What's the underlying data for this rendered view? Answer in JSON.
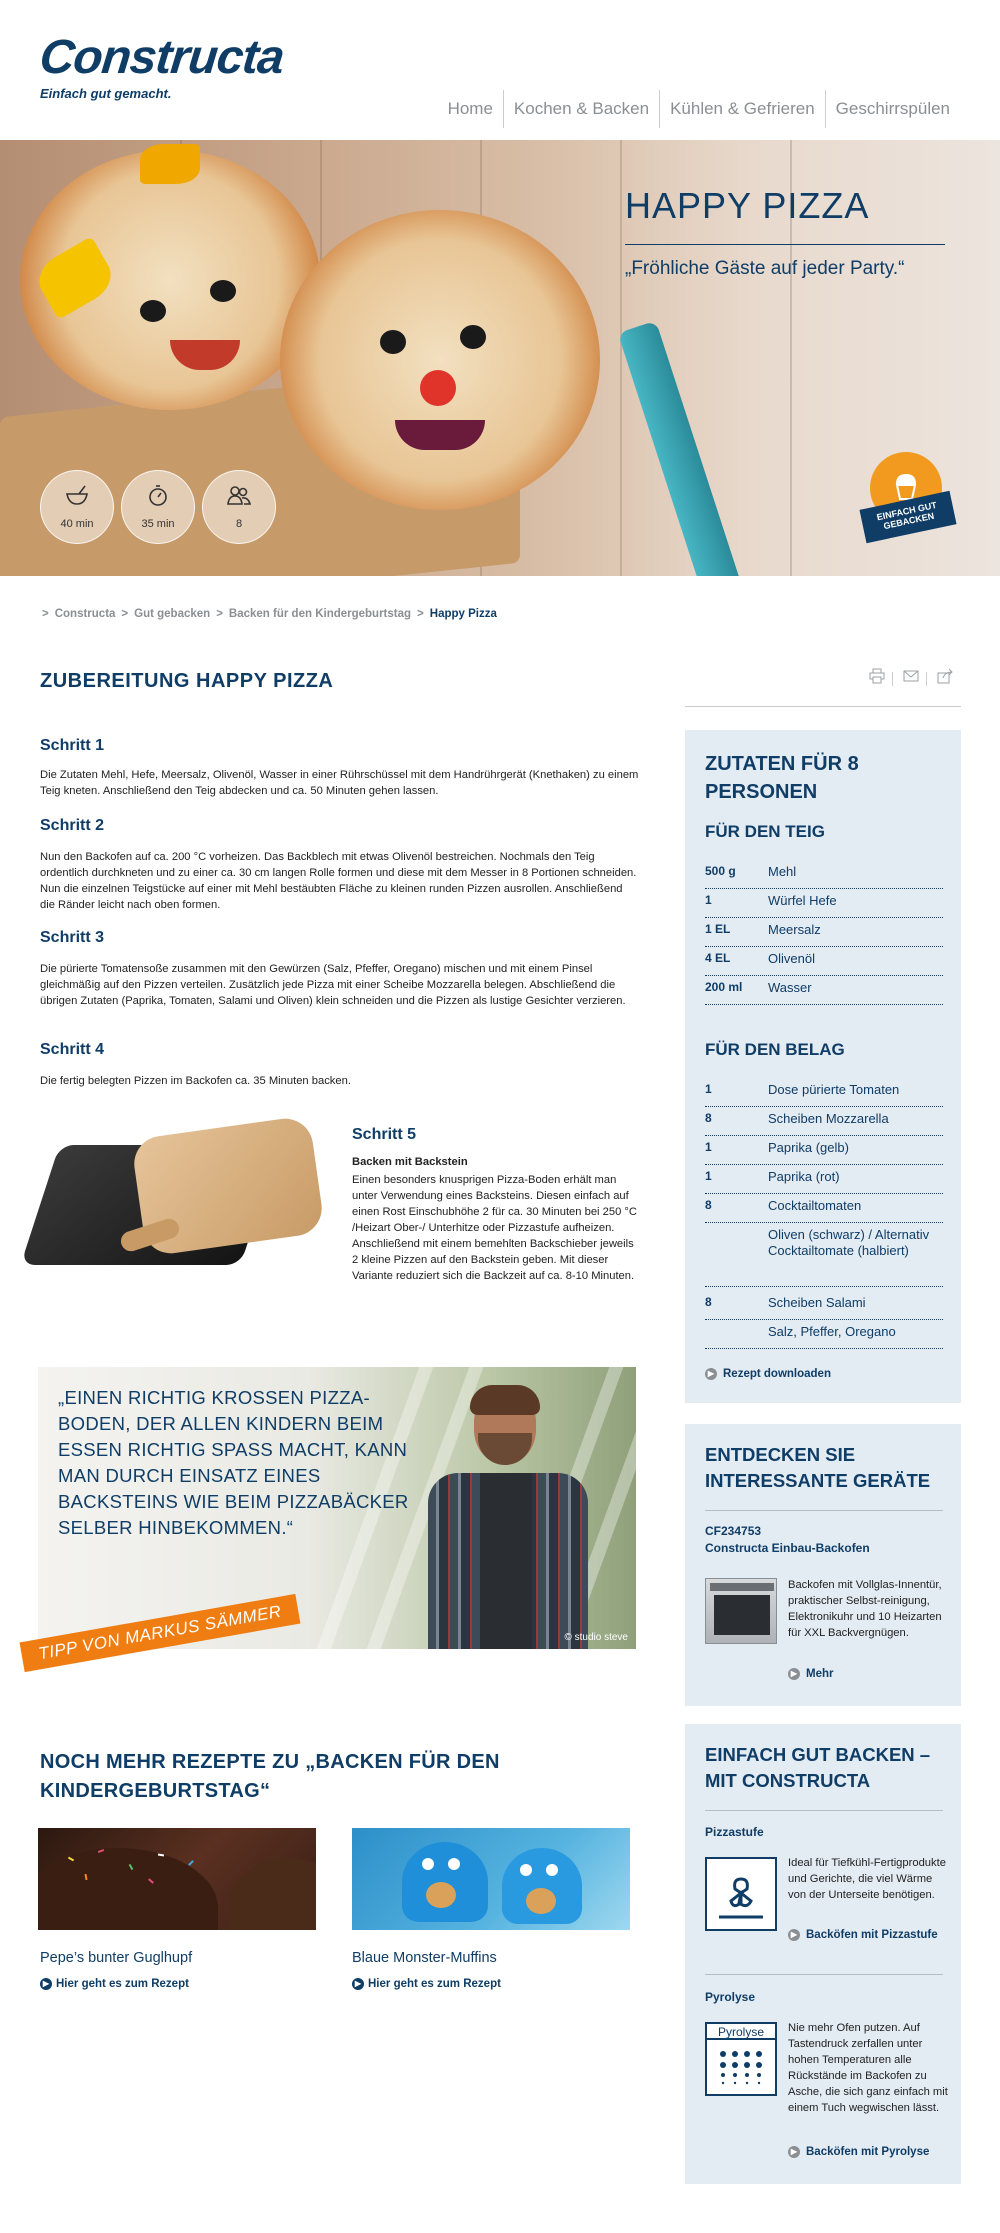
{
  "brand": {
    "logo": "Constructa",
    "tagline": "Einfach gut gemacht."
  },
  "nav": [
    "Home",
    "Kochen & Backen",
    "Kühlen & Gefrieren",
    "Geschirrspülen"
  ],
  "hero": {
    "title": "HAPPY PIZZA",
    "subtitle": "„Fröhliche Gäste auf jeder Party.“",
    "stats": [
      {
        "icon": "mixing-bowl-icon",
        "value": "40 min"
      },
      {
        "icon": "stopwatch-icon",
        "value": "35 min"
      },
      {
        "icon": "people-icon",
        "value": "8"
      }
    ],
    "badge": "EINFACH GUT GEBACKEN"
  },
  "breadcrumb": [
    "Constructa",
    "Gut gebacken",
    "Backen für den Kindergeburtstag",
    "Happy Pizza"
  ],
  "main": {
    "title": "ZUBEREITUNG HAPPY PIZZA",
    "steps": [
      {
        "title": "Schritt 1",
        "text": "Die Zutaten Mehl, Hefe, Meersalz, Olivenöl, Wasser in einer Rührschüssel mit dem Handrührgerät (Knethaken) zu einem Teig kneten. Anschließend den Teig abdecken und ca. 50 Minuten gehen lassen."
      },
      {
        "title": "Schritt 2",
        "text": "Nun den Backofen auf ca. 200 °C vorheizen. Das Backblech mit etwas Olivenöl bestreichen. Nochmals den Teig ordentlich durchkneten und zu einer ca. 30 cm langen Rolle formen und diese mit dem Messer in 8 Portionen schneiden. Nun die einzelnen Teigstücke auf einer mit Mehl bestäubten Fläche zu kleinen runden Pizzen ausrollen. Anschließend die Ränder leicht nach oben formen."
      },
      {
        "title": "Schritt 3",
        "text": "Die pürierte Tomatensoße zusammen mit den Gewürzen (Salz, Pfeffer, Oregano) mischen und mit einem Pinsel gleichmäßig auf den Pizzen verteilen. Zusätzlich jede Pizza mit einer Scheibe Mozzarella belegen. Abschließend die übrigen Zutaten (Paprika, Tomaten, Salami und Oliven) klein schneiden und die Pizzen als lustige Gesichter verzieren."
      },
      {
        "title": "Schritt 4",
        "text": "Die fertig belegten Pizzen im Backofen ca. 35 Minuten backen."
      }
    ],
    "step5": {
      "title": "Schritt 5",
      "subtitle": "Backen mit Backstein",
      "text": "Einen besonders knusprigen Pizza-Boden erhält man unter Verwendung eines Backsteins. Diesen einfach auf einen Rost Einschubhöhe 2 für ca. 30 Minuten bei 250 °C /Heizart Ober-/ Unterhitze oder Pizzastufe aufheizen. Anschließend mit einem bemehlten Backschieber jeweils 2 kleine Pizzen auf den Backstein geben. Mit dieser Variante reduziert sich die Backzeit auf ca. 8-10 Minuten."
    },
    "quote": {
      "text": "„EINEN RICHTIG KROSSEN PIZZA-BODEN, DER ALLEN KINDERN BEIM ESSEN RICHTIG SPASS MACHT, KANN MAN DURCH EINSATZ EINES BACKSTEINS WIE BEIM PIZZABÄCKER SELBER HINBEKOMMEN.“",
      "copyright": "© studio steve",
      "tip": "TIPP VON MARKUS SÄMMER"
    },
    "more": {
      "title": "NOCH MEHR REZEPTE ZU „BACKEN FÜR DEN KINDERGEBURTSTAG“",
      "recipes": [
        {
          "title": "Pepe’s bunter Guglhupf",
          "link": "Hier geht es zum Rezept"
        },
        {
          "title": "Blaue Monster-Muffins",
          "link": "Hier geht es zum Rezept"
        }
      ]
    }
  },
  "sidebar": {
    "ingredients": {
      "title": "ZUTATEN FÜR 8 PERSONEN",
      "dough_title": "FÜR DEN TEIG",
      "dough": [
        {
          "qty": "500 g",
          "name": "Mehl"
        },
        {
          "qty": "1",
          "name": "Würfel Hefe"
        },
        {
          "qty": "1 EL",
          "name": "Meersalz"
        },
        {
          "qty": "4 EL",
          "name": "Olivenöl"
        },
        {
          "qty": "200 ml",
          "name": "Wasser"
        }
      ],
      "topping_title": "FÜR DEN BELAG",
      "topping": [
        {
          "qty": "1",
          "name": "Dose pürierte Tomaten"
        },
        {
          "qty": "8",
          "name": "Scheiben Mozzarella"
        },
        {
          "qty": "1",
          "name": "Paprika (gelb)"
        },
        {
          "qty": "1",
          "name": "Paprika (rot)"
        },
        {
          "qty": "8",
          "name": "Cocktailtomaten"
        },
        {
          "qty": "",
          "name": "Oliven (schwarz) / Alternativ Cocktailtomate (halbiert)"
        },
        {
          "qty": "8",
          "name": "Scheiben Salami"
        },
        {
          "qty": "",
          "name": "Salz, Pfeffer, Oregano"
        }
      ],
      "download": "Rezept downloaden"
    },
    "devices": {
      "title": "ENTDECKEN SIE INTERESSANTE GERÄTE",
      "device_id": "CF234753",
      "device_name": "Constructa Einbau-Backofen",
      "device_text": "Backofen mit Vollglas-Innentür, praktischer Selbst-reinigung, Elektronikuhr und 10 Heizarten für XXL Backvergnügen.",
      "more": "Mehr"
    },
    "baking": {
      "title": "EINFACH GUT BACKEN – MIT CONSTRUCTA",
      "features": [
        {
          "title": "Pizzastufe",
          "text": "Ideal für Tiefkühl-Fertigprodukte und Gerichte, die viel Wärme von der Unterseite benötigen.",
          "link": "Backöfen mit Pizzastufe",
          "icon_label": ""
        },
        {
          "title": "Pyrolyse",
          "text": "Nie mehr Ofen putzen. Auf Tastendruck zerfallen unter hohen Temperaturen alle Rückstände im Backofen zu Asche, die sich ganz einfach mit einem Tuch wegwischen lässt.",
          "link": "Backöfen mit Pyrolyse",
          "icon_label": "Pyrolyse"
        }
      ]
    }
  },
  "colors": {
    "brand": "#0f3d66",
    "accent": "#f07d12",
    "sidebar_bg": "#e3ebf3"
  }
}
